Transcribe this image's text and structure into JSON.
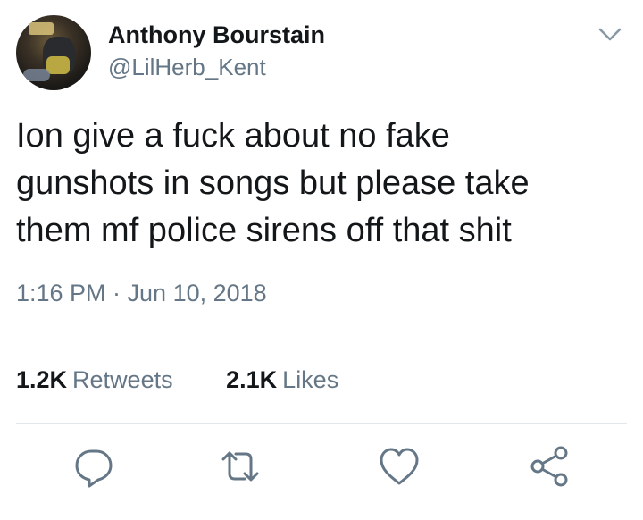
{
  "user": {
    "display_name": "Anthony Bourstain",
    "handle": "@LilHerb_Kent",
    "avatar_icon": "user-avatar-photo"
  },
  "tweet": {
    "text": "Ion give a fuck about no fake\ngunshots in songs but please take\nthem mf police sirens off that shit",
    "timestamp": "1:16 PM · Jun 10, 2018"
  },
  "stats": {
    "retweets_count": "1.2K",
    "retweets_label": "Retweets",
    "likes_count": "2.1K",
    "likes_label": "Likes"
  },
  "actions": [
    {
      "name": "reply",
      "icon": "reply-icon"
    },
    {
      "name": "retweet",
      "icon": "retweet-icon"
    },
    {
      "name": "like",
      "icon": "heart-icon"
    },
    {
      "name": "share",
      "icon": "share-icon"
    }
  ],
  "colors": {
    "text": "#14171a",
    "secondary": "#657786",
    "divider": "#e1e8ed",
    "icon": "#657786"
  }
}
